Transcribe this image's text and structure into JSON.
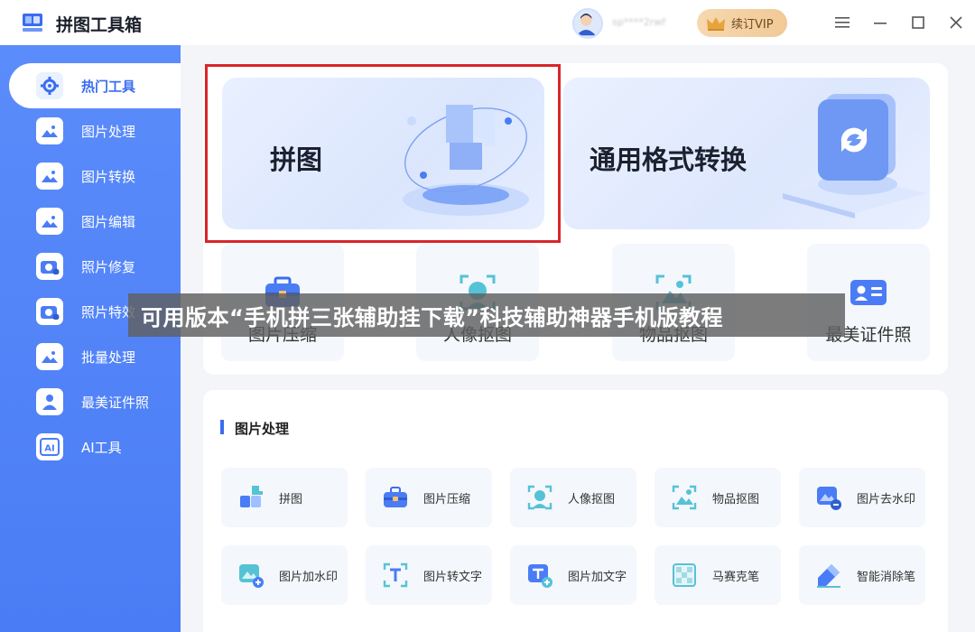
{
  "app": {
    "title": "拼图工具箱",
    "user_name": "sp****2rwf",
    "vip_label": "续订VIP"
  },
  "sidebar": {
    "items": [
      {
        "label": "热门工具",
        "icon": "gear-tools-icon",
        "active": true
      },
      {
        "label": "图片处理",
        "icon": "image-process-icon"
      },
      {
        "label": "图片转换",
        "icon": "image-convert-icon"
      },
      {
        "label": "图片编辑",
        "icon": "image-edit-icon"
      },
      {
        "label": "照片修复",
        "icon": "photo-repair-icon"
      },
      {
        "label": "照片特效",
        "icon": "photo-effect-icon"
      },
      {
        "label": "批量处理",
        "icon": "batch-process-icon"
      },
      {
        "label": "最美证件照",
        "icon": "id-photo-icon"
      },
      {
        "label": "AI工具",
        "icon": "ai-icon"
      }
    ]
  },
  "banners": [
    {
      "label": "拼图",
      "icon": "puzzle-3d-icon"
    },
    {
      "label": "通用格式转换",
      "icon": "convert-3d-icon"
    }
  ],
  "hot_tools": [
    {
      "label": "图片压缩",
      "icon": "toolbox-icon"
    },
    {
      "label": "人像抠图",
      "icon": "portrait-cutout-icon"
    },
    {
      "label": "物品抠图",
      "icon": "object-cutout-icon"
    },
    {
      "label": "最美证件照",
      "icon": "id-card-icon"
    }
  ],
  "overlay_text": "可用版本“手机拼三张辅助挂下载”科技辅助神器手机版教程",
  "section": {
    "title": "图片处理",
    "tools": [
      {
        "label": "拼图",
        "icon": "puzzle-icon"
      },
      {
        "label": "图片压缩",
        "icon": "toolbox-icon"
      },
      {
        "label": "人像抠图",
        "icon": "portrait-cutout-icon"
      },
      {
        "label": "物品抠图",
        "icon": "object-cutout-icon"
      },
      {
        "label": "图片去水印",
        "icon": "remove-watermark-icon"
      },
      {
        "label": "图片加水印",
        "icon": "add-watermark-icon"
      },
      {
        "label": "图片转文字",
        "icon": "image-to-text-icon"
      },
      {
        "label": "图片加文字",
        "icon": "add-text-icon"
      },
      {
        "label": "马赛克笔",
        "icon": "mosaic-brush-icon"
      },
      {
        "label": "智能消除笔",
        "icon": "smart-eraser-icon"
      }
    ]
  },
  "colors": {
    "accent": "#3a6df0",
    "sidebar": "#4f80f7",
    "highlight": "#d9262a",
    "vip": "#f3cf9e"
  }
}
